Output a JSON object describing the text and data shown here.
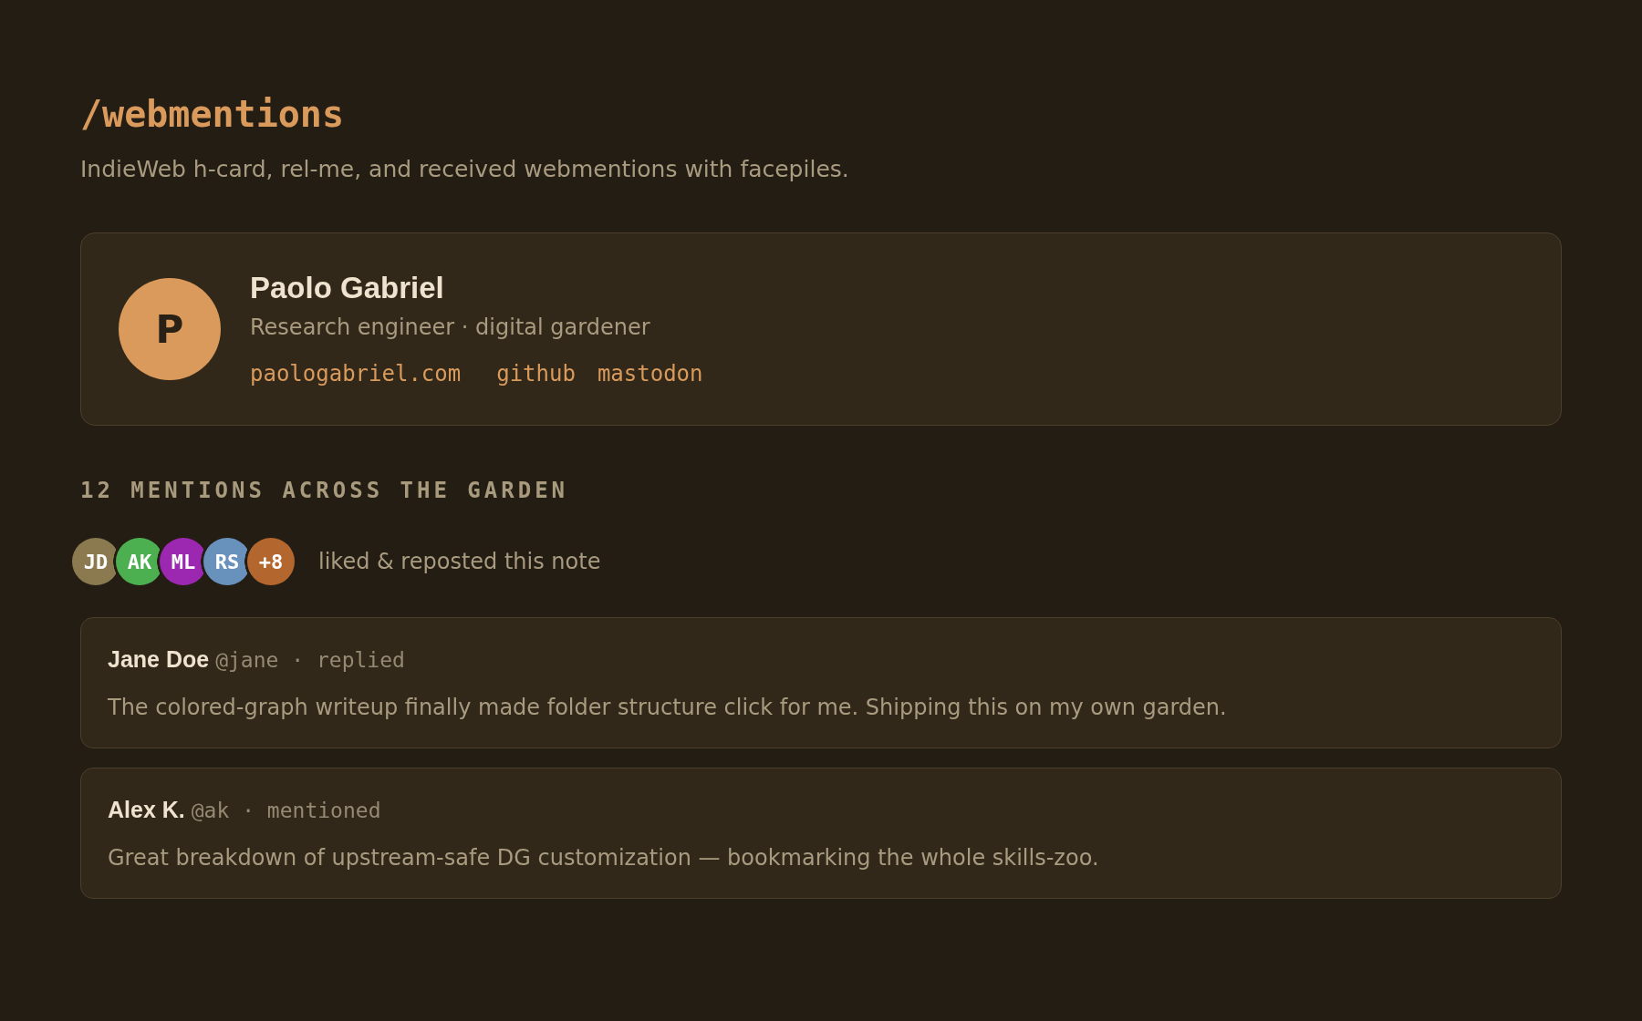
{
  "page": {
    "title": "/webmentions",
    "subtitle": "IndieWeb h-card, rel-me, and received webmentions with facepiles."
  },
  "h_card": {
    "avatar_initial": "P",
    "name": "Paolo Gabriel",
    "note": "Research engineer · digital gardener",
    "links": [
      "paologabriel.com",
      "github",
      "mastodon"
    ]
  },
  "mentions": {
    "heading": "12 MENTIONS ACROSS THE GARDEN",
    "facepile": [
      {
        "label": "JD",
        "color": "#8b7a50"
      },
      {
        "label": "AK",
        "color": "#4caf50"
      },
      {
        "label": "ML",
        "color": "#9c27b0"
      },
      {
        "label": "RS",
        "color": "#6891bb"
      },
      {
        "label": "+8",
        "color": "#b4662f"
      }
    ],
    "facepile_caption": "liked & reposted this note",
    "items": [
      {
        "author": "Jane Doe",
        "meta": "@jane · replied",
        "text": "The colored-graph writeup finally made folder structure click for me. Shipping this on my own garden."
      },
      {
        "author": "Alex K.",
        "meta": "@ak · mentioned",
        "text": "Great breakdown of upstream-safe DG customization — bookmarking the whole skills-zoo."
      }
    ]
  }
}
